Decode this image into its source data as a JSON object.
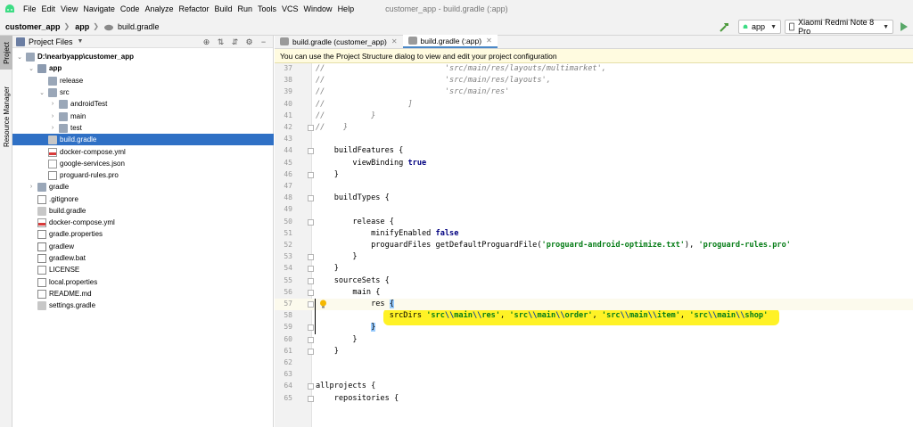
{
  "menubar": {
    "items": [
      "File",
      "Edit",
      "View",
      "Navigate",
      "Code",
      "Analyze",
      "Refactor",
      "Build",
      "Run",
      "Tools",
      "VCS",
      "Window",
      "Help"
    ],
    "window_title": "customer_app - build.gradle (:app)"
  },
  "navbar": {
    "crumbs": [
      "customer_app",
      "app",
      "build.gradle"
    ],
    "run_config": "app",
    "device": "Xiaomi Redmi Note 8 Pro"
  },
  "leftstrip": {
    "project_label": "Project",
    "resource_label": "Resource Manager"
  },
  "project_panel": {
    "title": "Project Files",
    "tree": [
      {
        "label": "D:\\nearbyapp\\customer_app",
        "bold": true
      },
      {
        "label": "app",
        "bold": true
      },
      {
        "label": "release"
      },
      {
        "label": "src"
      },
      {
        "label": "androidTest"
      },
      {
        "label": "main"
      },
      {
        "label": "test"
      },
      {
        "label": "build.gradle"
      },
      {
        "label": "docker-compose.yml"
      },
      {
        "label": "google-services.json"
      },
      {
        "label": "proguard-rules.pro"
      },
      {
        "label": "gradle"
      },
      {
        "label": ".gitignore"
      },
      {
        "label": "build.gradle"
      },
      {
        "label": "docker-compose.yml"
      },
      {
        "label": "gradle.properties"
      },
      {
        "label": "gradlew"
      },
      {
        "label": "gradlew.bat"
      },
      {
        "label": "LICENSE"
      },
      {
        "label": "local.properties"
      },
      {
        "label": "README.md"
      },
      {
        "label": "settings.gradle"
      }
    ]
  },
  "editor": {
    "tabs": [
      {
        "label": "build.gradle (customer_app)",
        "active": false
      },
      {
        "label": "build.gradle (:app)",
        "active": true
      }
    ],
    "banner": "You can use the Project Structure dialog to view and edit your project configuration",
    "line_numbers": [
      "37",
      "38",
      "39",
      "40",
      "41",
      "42",
      "43",
      "44",
      "45",
      "46",
      "47",
      "48",
      "49",
      "50",
      "51",
      "52",
      "53",
      "54",
      "55",
      "56",
      "57",
      "58",
      "59",
      "60",
      "61",
      "62",
      "63",
      "64",
      "65"
    ],
    "lines": [
      "//                          'src/main/res/layouts/multimarket',",
      "//                          'src/main/res/layouts',",
      "//                          'src/main/res'",
      "//                  ]",
      "//          }",
      "//    }",
      "",
      "    buildFeatures {",
      "        viewBinding true",
      "    }",
      "",
      "    buildTypes {",
      "",
      "        release {",
      "            minifyEnabled false",
      "            proguardFiles getDefaultProguardFile('proguard-android-optimize.txt'), 'proguard-rules.pro'",
      "        }",
      "    }",
      "    sourceSets {",
      "        main {",
      "            res {",
      "                srcDirs 'src\\\\main\\\\res', 'src\\\\main\\\\order', 'src\\\\main\\\\item', 'src\\\\main\\\\shop'",
      "            }",
      "        }",
      "    }",
      "",
      "",
      "allprojects {",
      "    repositories {"
    ]
  }
}
